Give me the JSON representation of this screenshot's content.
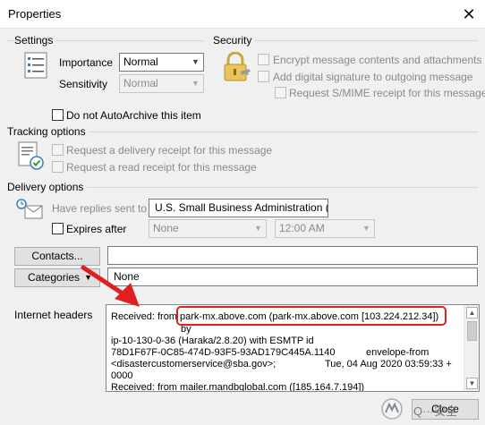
{
  "window": {
    "title": "Properties",
    "close_glyph": "✕"
  },
  "settings": {
    "title": "Settings",
    "importance_label": "Importance",
    "importance_value": "Normal",
    "sensitivity_label": "Sensitivity",
    "sensitivity_value": "Normal"
  },
  "security": {
    "title": "Security",
    "encrypt_label": "Encrypt message contents and attachments",
    "signature_label": "Add digital signature to outgoing message",
    "smime_label": "Request S/MIME receipt for this message"
  },
  "autoarchive_label": "Do not AutoArchive this item",
  "tracking": {
    "title": "Tracking options",
    "delivery_receipt_label": "Request a delivery receipt for this message",
    "read_receipt_label": "Request a read receipt for this message"
  },
  "delivery": {
    "title": "Delivery options",
    "replies_label": "Have replies sent to",
    "replies_value": "U.S. Small Business Administration (SE",
    "expires_label": "Expires after",
    "expires_date": "None",
    "expires_time": "12:00 AM"
  },
  "contacts": {
    "button_label": "Contacts...",
    "value": ""
  },
  "categories": {
    "button_label": "Categories",
    "value": "None"
  },
  "internet_headers": {
    "label": "Internet headers",
    "lines": [
      "Received: from park-mx.above.com (park-mx.above.com [103.224.212.34])",
      "by",
      "ip-10-130-0-36 (Haraka/2.8.20) with ESMTP id",
      "78D1F67F-0C85-474D-93F5-93AD179C445A.1140",
      "envelope-from",
      "<disastercustomerservice@sba.gov>;",
      "Tue, 04 Aug 2020 03:59:33 +",
      "0000",
      "Received: from mailer.mandbqlobal.com ([185.164.7.194])"
    ]
  },
  "footer": {
    "close_label": "Close"
  },
  "watermark": {
    "text": "Q···安全"
  },
  "colors": {
    "annotation_red": "#e02020",
    "accent": "#3c7fb1"
  }
}
